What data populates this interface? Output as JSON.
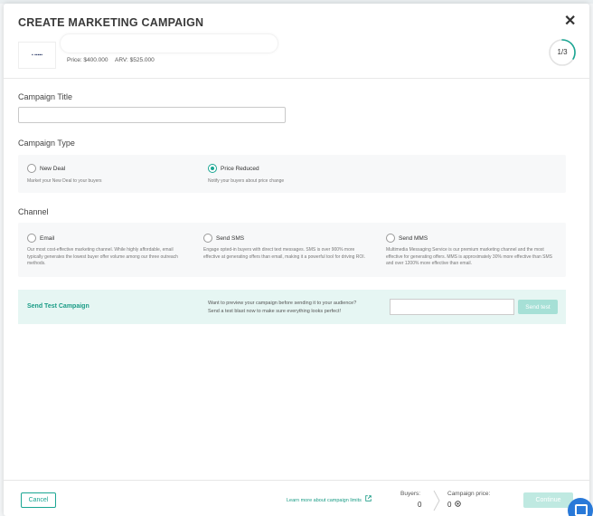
{
  "modal": {
    "title": "CREATE MARKETING CAMPAIGN",
    "close_glyph": "✕",
    "logo_text": "▪ ▪▪▪▪▪",
    "property": {
      "price": "Price: $400.000",
      "arv": "ARV: $525.000"
    },
    "step": {
      "text": "1/3",
      "current": 1,
      "total": 3
    }
  },
  "campaign_title": {
    "label": "Campaign Title",
    "value": "",
    "placeholder": ""
  },
  "campaign_type": {
    "label": "Campaign Type",
    "options": [
      {
        "label": "New Deal",
        "description": "Market your New Deal to your buyers",
        "checked": false
      },
      {
        "label": "Price Reduced",
        "description": "Notify your buyers about price change",
        "checked": true
      }
    ]
  },
  "channel": {
    "label": "Channel",
    "options": [
      {
        "label": "Email",
        "description": "Our most cost-effective marketing channel. While highly affordable, email typically generates the lowest buyer offer volume among our three outreach methods.",
        "checked": false
      },
      {
        "label": "Send SMS",
        "description": "Engage opted-in buyers with direct text messages. SMS is over 900% more effective at generating offers than email, making it a powerful tool for driving ROI.",
        "checked": false
      },
      {
        "label": "Send MMS",
        "description": "Multimedia Messaging Service is our premium marketing channel and the most effective for generating offers. MMS is approximately 30% more effective than SMS and over 1200% more effective than email.",
        "checked": false
      }
    ]
  },
  "test_campaign": {
    "title": "Send Test Campaign",
    "description_line1": "Want to preview your campaign before sending it to your audience?",
    "description_line2": "Send a test blast now to make sure everything looks perfect!",
    "input_value": "",
    "button_label": "Send test"
  },
  "footer": {
    "cancel_label": "Cancel",
    "learn_more_label": "Learn more about campaign limits",
    "buyers_label": "Buyers:",
    "buyers_value": "0",
    "campaign_price_label": "Campaign price:",
    "campaign_price_value": "0",
    "continue_label": "Continue"
  },
  "colors": {
    "accent": "#1aa693",
    "accent_light": "#bfe9e1",
    "test_panel_bg": "#e6f6f3",
    "chat_bubble": "#2979d8"
  },
  "icons": {
    "close": "close-icon",
    "external_link": "external-link-icon",
    "coin": "coin-icon",
    "chevron": "chevron-right-icon",
    "chat": "chat-icon"
  }
}
